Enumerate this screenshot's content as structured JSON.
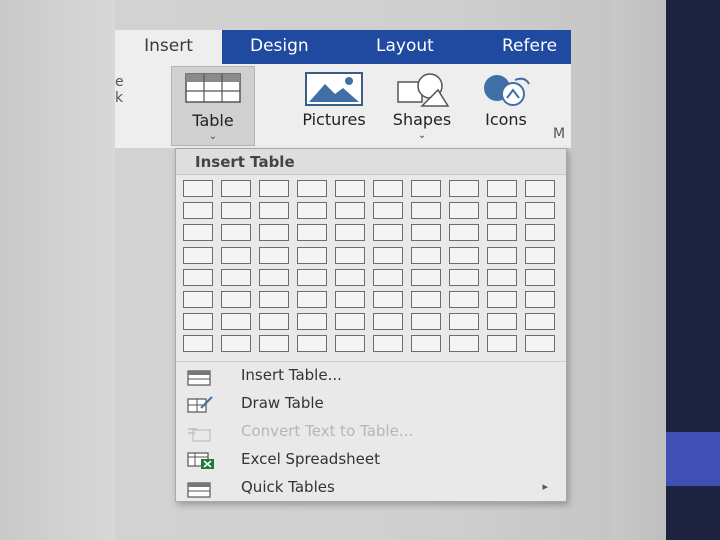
{
  "ribbon": {
    "tabs": [
      {
        "label": "Insert"
      },
      {
        "label": "Design"
      },
      {
        "label": "Layout"
      },
      {
        "label": "Refere"
      }
    ],
    "buttons": {
      "table": "Table",
      "pictures": "Pictures",
      "shapes": "Shapes",
      "icons": "Icons"
    },
    "edge_text": "e\nk",
    "group_hint": "M",
    "caret": "⌄"
  },
  "insert_table": {
    "title": "Insert Table",
    "grid_columns": 10,
    "grid_rows": 8
  },
  "menu": [
    {
      "label": "Insert Table...",
      "enabled": true
    },
    {
      "label": "Draw Table",
      "enabled": true
    },
    {
      "label": "Convert Text to Table...",
      "enabled": false
    },
    {
      "label": "Excel Spreadsheet",
      "enabled": true
    },
    {
      "label": "Quick Tables",
      "enabled": true,
      "submenu_arrow": "▸"
    }
  ],
  "colors": {
    "tab_strip": "#1f4aa0",
    "right_panel": "#1e2440",
    "right_accent": "#3f4fb3",
    "excel_green": "#1d7a3a"
  }
}
